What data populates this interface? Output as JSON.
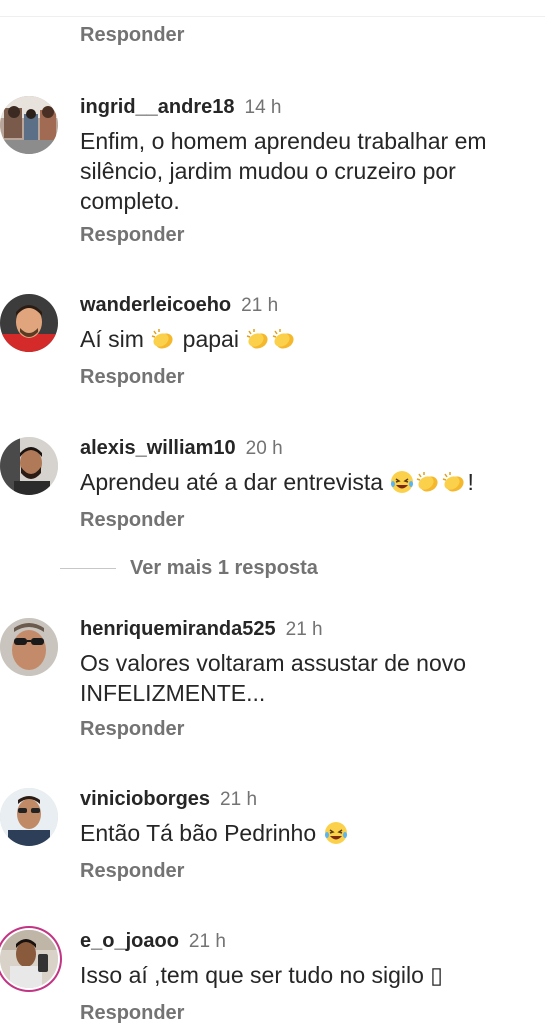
{
  "top_reply_label": "Responder",
  "comments": [
    {
      "username": "ingrid__andre18",
      "time": "14 h",
      "text": "Enfim, o homem aprendeu trabalhar em silêncio, jardim mudou o cruzeiro por completo.",
      "reply_label": "Responder"
    },
    {
      "username": "wanderleicoeho",
      "time": "21 h",
      "text_parts": [
        "Aí sim",
        "papai"
      ],
      "reply_label": "Responder"
    },
    {
      "username": "alexis_william10",
      "time": "20 h",
      "text_parts": [
        "Aprendeu até a dar entrevista",
        "!"
      ],
      "reply_label": "Responder"
    },
    {
      "username": "henriquemiranda525",
      "time": "21 h",
      "text": "Os valores voltaram assustar de novo INFELIZMENTE...",
      "reply_label": "Responder"
    },
    {
      "username": "vinicioborges",
      "time": "21 h",
      "text": "Então Tá bão Pedrinho",
      "reply_label": "Responder"
    },
    {
      "username": "e_o_joaoo",
      "time": "21 h",
      "text": "Isso aí ,tem que ser tudo no sigilo ▯",
      "reply_label": "Responder"
    }
  ],
  "view_more_replies": "Ver mais 1 resposta",
  "icons": {
    "clap": "clapping-hands-emoji",
    "laugh": "laughing-face-emoji"
  },
  "colors": {
    "text": "#262626",
    "secondary": "#737373",
    "divider": "#efefef",
    "story_ring": "#c13584"
  }
}
